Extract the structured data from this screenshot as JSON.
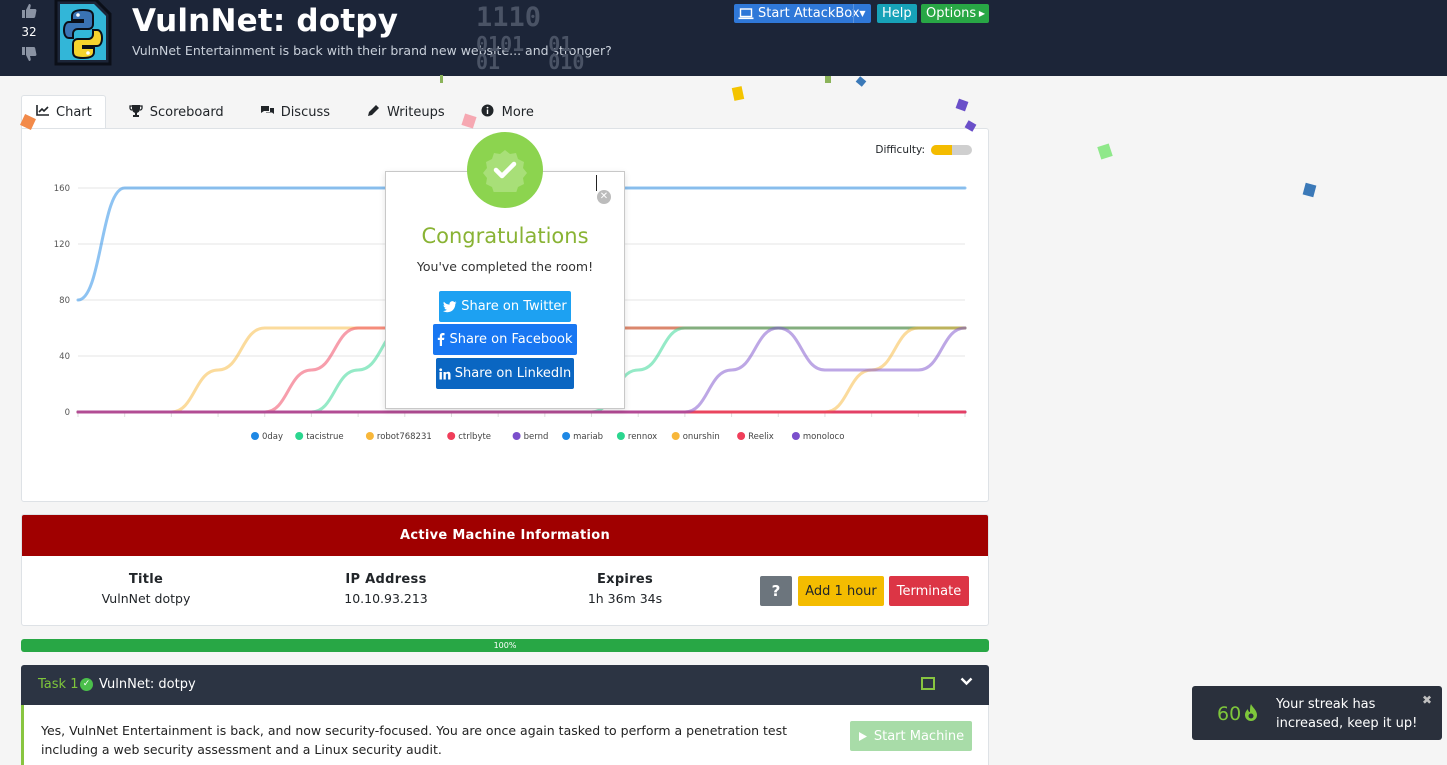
{
  "header": {
    "title": "VulnNet: dotpy",
    "subtitle": "VulnNet Entertainment is back with their brand new website... and stronger?",
    "vote_count": "32",
    "binary_lines": [
      "1110",
      "0101  01",
      "01    010",
      "01"
    ],
    "buttons": {
      "attackbox": "Start AttackBox",
      "help": "Help",
      "options": "Options"
    },
    "icons": [
      "thumbs-up-icon",
      "thumbs-down-icon",
      "python-room-icon",
      "laptop-icon",
      "caret-down-icon",
      "caret-right-icon"
    ]
  },
  "tabs": [
    {
      "label": "Chart",
      "icon": "line-chart-icon",
      "active": true
    },
    {
      "label": "Scoreboard",
      "icon": "trophy-icon",
      "active": false
    },
    {
      "label": "Discuss",
      "icon": "comments-icon",
      "active": false
    },
    {
      "label": "Writeups",
      "icon": "pencil-icon",
      "active": false
    },
    {
      "label": "More",
      "icon": "info-circle-icon",
      "active": false
    }
  ],
  "difficulty": {
    "label": "Difficulty:",
    "level": 0.5,
    "color": "#f4bc00"
  },
  "chart_data": {
    "type": "line",
    "x": [
      0,
      1,
      2,
      3,
      4,
      5,
      6,
      7,
      8,
      9,
      10,
      11,
      12,
      13,
      14,
      15,
      16,
      17,
      18,
      19
    ],
    "ylim": [
      0,
      160
    ],
    "yticks": [
      0,
      40,
      80,
      120,
      160
    ],
    "grid": true,
    "legend_position": "bottom",
    "series": [
      {
        "name": "0day",
        "color": "#1e88e5",
        "values": [
          0,
          0,
          0,
          0,
          0,
          0,
          0,
          0,
          0,
          0,
          0,
          0,
          0,
          0,
          0,
          0,
          0,
          0,
          0,
          0
        ]
      },
      {
        "name": "tacistrue",
        "color": "#2bd68f",
        "values": [
          0,
          0,
          0,
          0,
          0,
          0,
          30,
          60,
          60,
          60,
          60,
          60,
          60,
          60,
          60,
          60,
          60,
          60,
          60,
          60
        ]
      },
      {
        "name": "robot768231",
        "color": "#f8b73a",
        "values": [
          0,
          0,
          0,
          30,
          60,
          60,
          60,
          60,
          60,
          60,
          60,
          60,
          60,
          60,
          60,
          60,
          60,
          60,
          60,
          60
        ]
      },
      {
        "name": "ctrlbyte",
        "color": "#f03e5a",
        "values": [
          0,
          0,
          0,
          0,
          0,
          30,
          60,
          60,
          60,
          60,
          60,
          60,
          60,
          60,
          60,
          60,
          60,
          60,
          60,
          60
        ]
      },
      {
        "name": "bernd",
        "color": "#7b4fcc",
        "values": [
          0,
          0,
          0,
          0,
          0,
          0,
          0,
          0,
          0,
          0,
          0,
          0,
          0,
          0,
          0,
          0,
          0,
          0,
          0,
          0
        ]
      },
      {
        "name": "mariab",
        "color": "#1e88e5",
        "values": [
          80,
          160,
          160,
          160,
          160,
          160,
          160,
          160,
          160,
          160,
          160,
          160,
          160,
          160,
          160,
          160,
          160,
          160,
          160,
          160
        ]
      },
      {
        "name": "rennox",
        "color": "#2bd68f",
        "values": [
          0,
          0,
          0,
          0,
          0,
          0,
          0,
          0,
          0,
          0,
          0,
          0,
          30,
          60,
          60,
          60,
          60,
          60,
          60,
          60
        ]
      },
      {
        "name": "onurshin",
        "color": "#f8b73a",
        "values": [
          0,
          0,
          0,
          0,
          0,
          0,
          0,
          0,
          0,
          0,
          0,
          0,
          0,
          0,
          0,
          0,
          0,
          30,
          60,
          60
        ]
      },
      {
        "name": "Reelix",
        "color": "#f03e5a",
        "values": [
          0,
          0,
          0,
          0,
          0,
          0,
          0,
          0,
          0,
          0,
          0,
          0,
          0,
          0,
          0,
          0,
          0,
          0,
          0,
          0
        ]
      },
      {
        "name": "monoloco",
        "color": "#7b4fcc",
        "values": [
          0,
          0,
          0,
          0,
          0,
          0,
          0,
          0,
          0,
          0,
          0,
          0,
          0,
          0,
          30,
          60,
          30,
          30,
          30,
          60
        ]
      }
    ]
  },
  "modal": {
    "title": "Congratulations",
    "message": "You've completed the room!",
    "share_twitter": "Share on Twitter",
    "share_facebook": "Share on Facebook",
    "share_linkedin": "Share on LinkedIn",
    "badge_color": "#8cd44f",
    "icons": [
      "check-badge-icon",
      "close-icon",
      "twitter-icon",
      "facebook-icon",
      "linkedin-icon"
    ]
  },
  "machine": {
    "header": "Active Machine Information",
    "title_label": "Title",
    "title_value": "VulnNet dotpy",
    "ip_label": "IP Address",
    "ip_value": "10.10.93.213",
    "expires_label": "Expires",
    "expires_value": "1h 36m 34s",
    "help_label": "?",
    "add_label": "Add 1 hour",
    "terminate_label": "Terminate"
  },
  "progress": {
    "value": 1.0,
    "label": "100%"
  },
  "task": {
    "number": "Task 1",
    "name": "VulnNet: dotpy",
    "text": "Yes, VulnNet Entertainment is back, and now security-focused. You are once again tasked to perform a penetration test including a web security assessment and a Linux security audit.",
    "start_machine": "Start Machine"
  },
  "toast": {
    "streak": "60",
    "message": "Your streak has increased, keep it up!"
  }
}
